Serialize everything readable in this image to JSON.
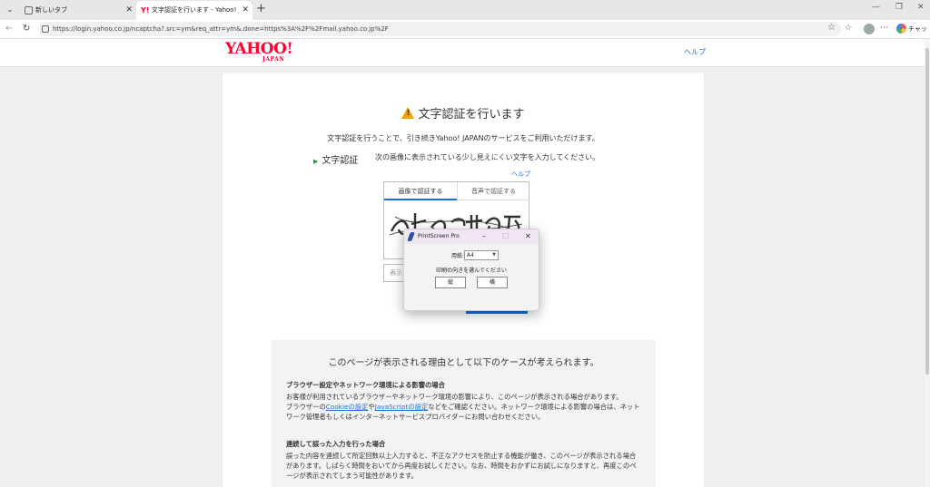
{
  "browser": {
    "tabs": [
      {
        "label": "新しいタブ"
      },
      {
        "label": "文字認証を行います - Yahoo! JAPAN"
      }
    ],
    "new_tab": "+",
    "url": "https://login.yahoo.co.jp/ncaptcha?.src=ym&req_attr=ym&.done=https%3A%2F%2Fmail.yahoo.co.jp%2F",
    "chat_label": "チャット"
  },
  "header": {
    "logo_main": "YAHOO!",
    "logo_sub": "JAPAN",
    "help": "ヘルプ"
  },
  "main": {
    "title": "文字認証を行います",
    "intro": "文字認証を行うことで、引き続きYahoo! JAPANのサービスをご利用いただけます。",
    "section_label": "文字認証",
    "section_desc": "次の画像に表示されている少し見えにくい文字を入力してください。",
    "help": "ヘルプ",
    "captcha_tab_image": "画像で認証する",
    "captcha_tab_audio": "音声で認証する",
    "input_placeholder": "表示"
  },
  "reasons": {
    "title": "このページが表示される理由として以下のケースが考えられます。",
    "h1": "ブラウザー設定やネットワーク環境による影響の場合",
    "p1_a": "お客様が利用されているブラウザーやネットワーク環境の影響により、このページが表示される場合があります。",
    "p1_b": "ブラウザーの",
    "p1_link1": "Cookieの設定",
    "p1_c": "や",
    "p1_link2": "JavaScriptの設定",
    "p1_d": "などをご確認ください。ネットワーク環境による影響の場合は、ネットワーク管理者もしくはインターネットサービスプロバイダーにお問い合わせください。",
    "h2": "連続して誤った入力を行った場合",
    "p2": "誤った内容を連続して所定回数以上入力すると、不正なアクセスを防止する機能が働き、このページが表示される場合があります。しばらく時間をおいてから再度お試しください。なお、時間をおかずにお試しになりますと、再度このページが表示されてしまう可能性があります。"
  },
  "dialog": {
    "title": "PrintScreen Pro",
    "paper_label": "用紙:",
    "paper_value": "A4",
    "prompt": "印刷の向きを選んでください",
    "portrait": "縦",
    "landscape": "横"
  },
  "colors": {
    "yahoo_red": "#ff0033",
    "link_blue": "#1a6fd8",
    "warning": "#f3a300"
  }
}
